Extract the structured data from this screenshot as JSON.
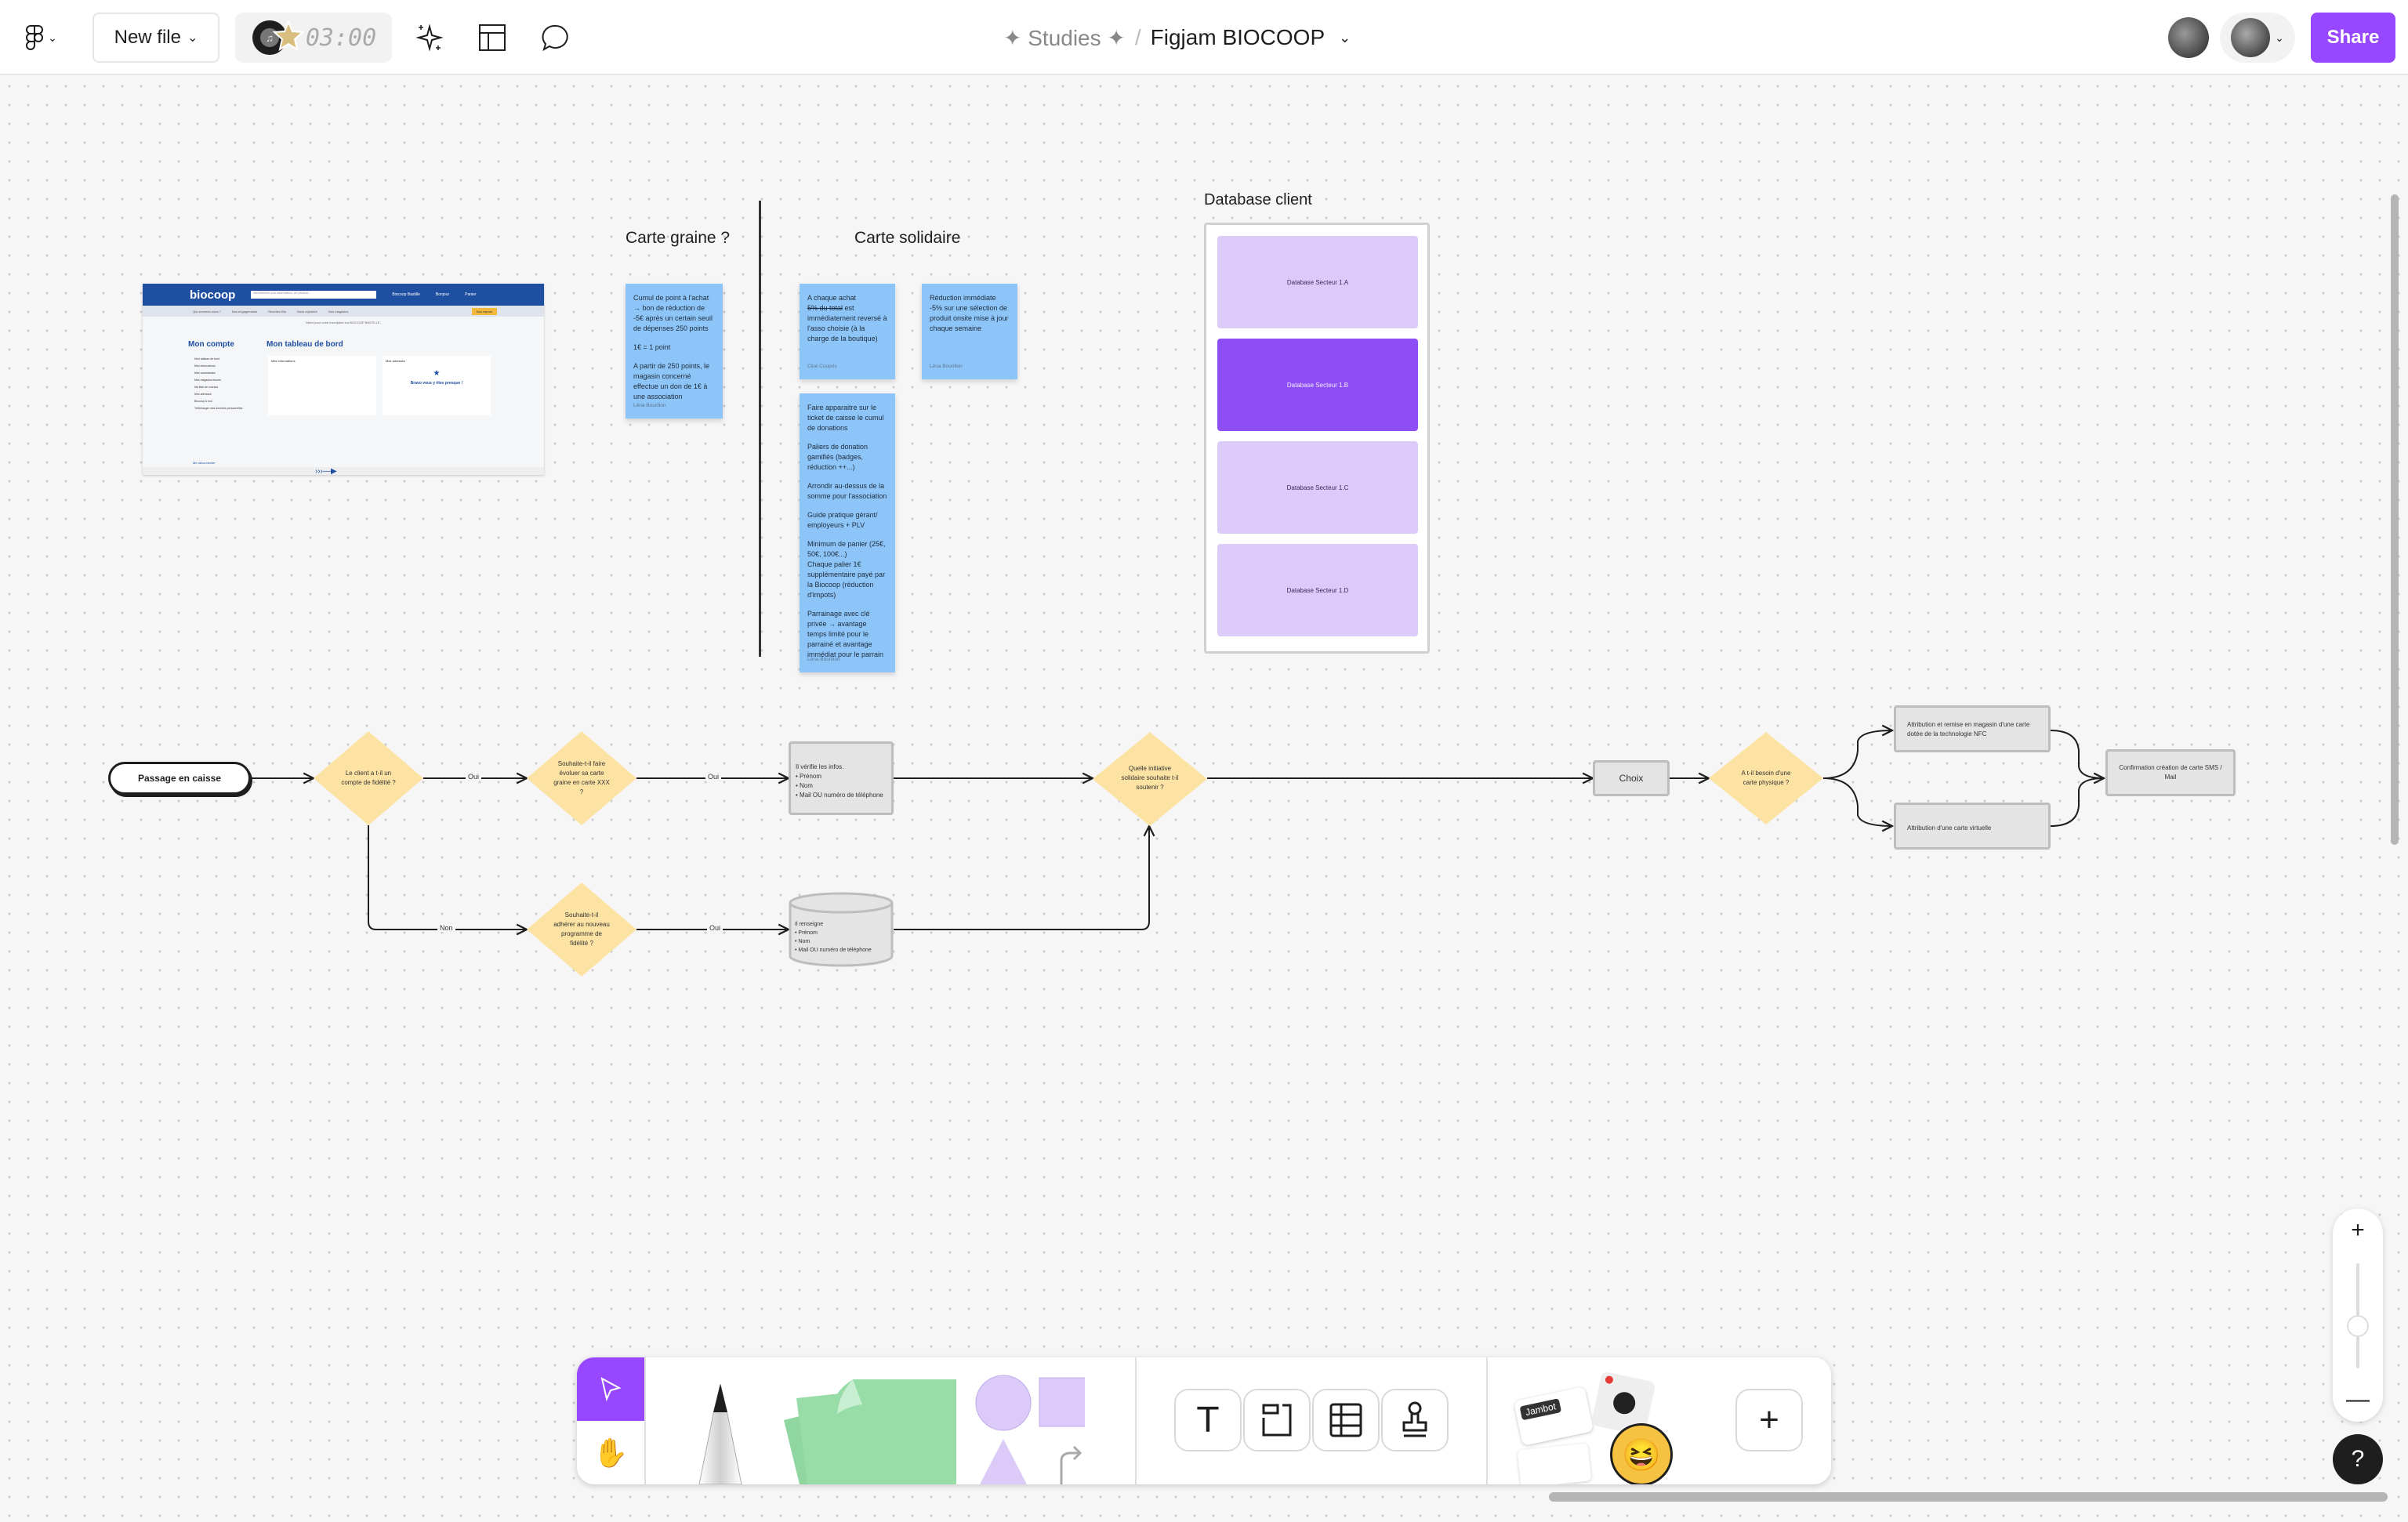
{
  "topbar": {
    "menu_icon": "figma-logo-icon",
    "file_menu_label": "New file",
    "timer": "03:00",
    "timer_icon": "music-timer-icon",
    "ai_icon": "sparkle-icon",
    "templates_icon": "layout-icon",
    "comments_icon": "comment-icon",
    "breadcrumb_project": "✦ Studies ✦",
    "breadcrumb_sep": "/",
    "file_title": "Figjam BIOCOOP",
    "share_label": "Share",
    "accent": "#9747ff"
  },
  "board": {
    "screenshot": {
      "brand": "biocoop",
      "search_placeholder": "Rechercher une information, un produit...",
      "store": "Biocoop Bastille",
      "greeting": "Bonjour",
      "cart": "Panier",
      "nav": [
        "Qui sommes-nous ?",
        "Nos engagements",
        "Recettes Bio",
        "Nous rejoindre",
        "Nos magasins"
      ],
      "rayons": "Nos rayons",
      "banner": "Merci pour votre inscription sur BIOCOOP BASTILLE.",
      "account_title": "Mon compte",
      "dashboard_title": "Mon tableau de bord",
      "menu": [
        "Mon tableau de bord",
        "Mes informations",
        "Mes commandes",
        "Mes magasins favoris",
        "Ma liste de courses",
        "Mes adresses",
        "Biocoop & moi",
        "Télécharger mes données personnelles"
      ],
      "info_title": "Mes informations",
      "addr_title": "Mes adresses",
      "bravo": "Bravo vous y êtes presque !",
      "logout": "Me déconnecter"
    },
    "carte_graine": {
      "title": "Carte graine ?",
      "sticky": {
        "paragraphs": [
          "Cumul de point à l'achat → bon de réduction de -5€ après un certain seuil de dépenses 250 points",
          "1€ = 1 point",
          "A partir de 250 points, le magasin concerné effectue un don de 1€ à une association"
        ],
        "author": "Léna Bourillon"
      }
    },
    "carte_solidaire": {
      "title": "Carte solidaire",
      "stickies": [
        {
          "line1": "A chaque achat",
          "strike": "5% du total",
          "rest": " est immédiatement reversé à l'asso choisie (à la charge de la boutique)",
          "author": "Cloé Coupris"
        },
        {
          "text": "Réduction immédiate -5% sur une sélection de produit onsite mise à jour chaque semaine",
          "author": "Léna Bourillon"
        },
        {
          "paragraphs": [
            "Faire apparaitre sur le ticket de caisse le cumul de donations",
            "Paliers de donation gamifiés (badges, réduction ++...)",
            "Arrondir au-dessus de la somme pour l'association",
            "Guide pratique gérant/ employeurs + PLV",
            "Minimum de panier (25€, 50€, 100€...)\nChaque palier 1€ supplémentaire payé par la Biocoop (réduction d'impots)",
            "Parrainage avec clé privée → avantage temps limité pour le parrainé et avantage immédiat pour le parrain"
          ],
          "author": "Léna Bourillon"
        }
      ]
    },
    "database": {
      "title": "Database client",
      "items": [
        "Database Secteur 1.A",
        "Database Secteur 1.B",
        "Database Secteur 1.C",
        "Database Secteur 1.D"
      ],
      "active_index": 1
    },
    "flow": {
      "start": "Passage en caisse",
      "d1": "Le client a t-il un compte de fidélité ?",
      "d2": "Souhaite-t-il faire évoluer sa carte graine en carte XXX ?",
      "p1_title": "Il vérifie les infos.",
      "p1_items": [
        "Prénom",
        "Nom",
        "Mail OU numéro de téléphone"
      ],
      "d3": "Quelle initiative solidaire souhaite t-il soutenir ?",
      "d4": "Souhaite-t-il adhérer au nouveau programme de fidélité ?",
      "db_title": "Il renseigne",
      "db_items": [
        "Prénom",
        "Nom",
        "Mail OU numéro de téléphone"
      ],
      "choix": "Choix",
      "d5": "A t-il besoin d'une carte physique ?",
      "p_nfc": "Attribution et remise en magasin d'une carte dotée de la technologie NFC",
      "p_virt": "Attribution d'une carte virtuelle",
      "p_conf": "Confirmation création de carte SMS / Mail",
      "oui": "Oui",
      "non": "Non"
    }
  },
  "toolbar": {
    "tools": [
      "select-tool",
      "hand-tool",
      "marker-tool",
      "sticky-note-tool",
      "shapes-tool",
      "connector-tool",
      "text-tool",
      "section-tool",
      "table-tool",
      "stamp-tool",
      "widgets-tool",
      "more-tool"
    ],
    "jambot_label": "Jambot"
  },
  "zoom": {
    "level_fraction": 0.6
  },
  "help_label": "?"
}
